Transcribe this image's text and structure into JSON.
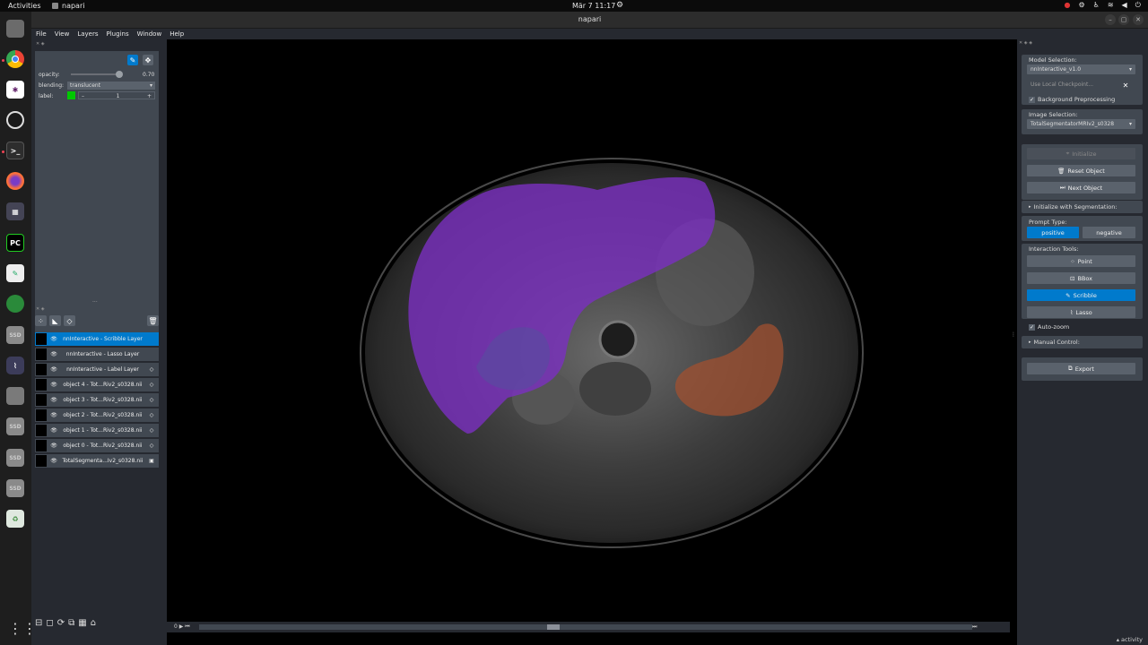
{
  "topbar": {
    "activities": "Activities",
    "app_name": "napari",
    "clock": "Mär 7  11:17"
  },
  "window": {
    "title": "napari"
  },
  "menu": [
    "File",
    "View",
    "Layers",
    "Plugins",
    "Window",
    "Help"
  ],
  "layer_controls": {
    "opacity_label": "opacity:",
    "opacity_value": "0.70",
    "opacity_fraction": 0.7,
    "blending_label": "blending:",
    "blending_value": "translucent",
    "label_label": "label:",
    "label_value": "1",
    "label_color": "#00c800"
  },
  "layers": [
    {
      "name": "nnInteractive - Scribble Layer",
      "selected": true,
      "visible": true,
      "type_icon": ""
    },
    {
      "name": "nnInteractive - Lasso Layer",
      "selected": false,
      "visible": true,
      "type_icon": ""
    },
    {
      "name": "nnInteractive - Label Layer",
      "selected": false,
      "visible": true,
      "type_icon": "◇"
    },
    {
      "name": "object 4 - Tot...Riv2_s0328.nii",
      "selected": false,
      "visible": true,
      "type_icon": "◇"
    },
    {
      "name": "object 3 - Tot...Riv2_s0328.nii",
      "selected": false,
      "visible": true,
      "type_icon": "◇"
    },
    {
      "name": "object 2 - Tot...Riv2_s0328.nii",
      "selected": false,
      "visible": true,
      "type_icon": "◇"
    },
    {
      "name": "object 1 - Tot...Riv2_s0328.nii",
      "selected": false,
      "visible": true,
      "type_icon": "◇"
    },
    {
      "name": "object 0 - Tot...Riv2_s0328.nii",
      "selected": false,
      "visible": true,
      "type_icon": "◇"
    },
    {
      "name": "TotalSegmenta...Iv2_s0328.nii",
      "selected": false,
      "visible": true,
      "type_icon": "▣"
    }
  ],
  "plugin": {
    "model_selection_label": "Model Selection:",
    "model_value": "nnInteractive_v1.0",
    "checkpoint_placeholder": "Use Local Checkpoint...",
    "background_preprocessing": "Background Preprocessing",
    "image_selection_label": "Image Selection:",
    "image_value": "TotalSegmentatorMRIv2_s0328",
    "initialize": "Initialize",
    "reset_object": "Reset Object",
    "next_object": "Next Object",
    "init_with_seg": "Initialize with Segmentation:",
    "prompt_type_label": "Prompt Type:",
    "positive": "positive",
    "negative": "negative",
    "interaction_tools_label": "Interaction Tools:",
    "point": "Point",
    "bbox": "BBox",
    "scribble": "Scribble",
    "lasso": "Lasso",
    "auto_zoom": "Auto-zoom",
    "manual_control": "Manual Control:",
    "export": "Export"
  },
  "status": {
    "activity": "activity"
  },
  "colors": {
    "accent": "#007acc",
    "liver_overlay": "#7a2fc0",
    "spleen_overlay": "#a05030"
  }
}
